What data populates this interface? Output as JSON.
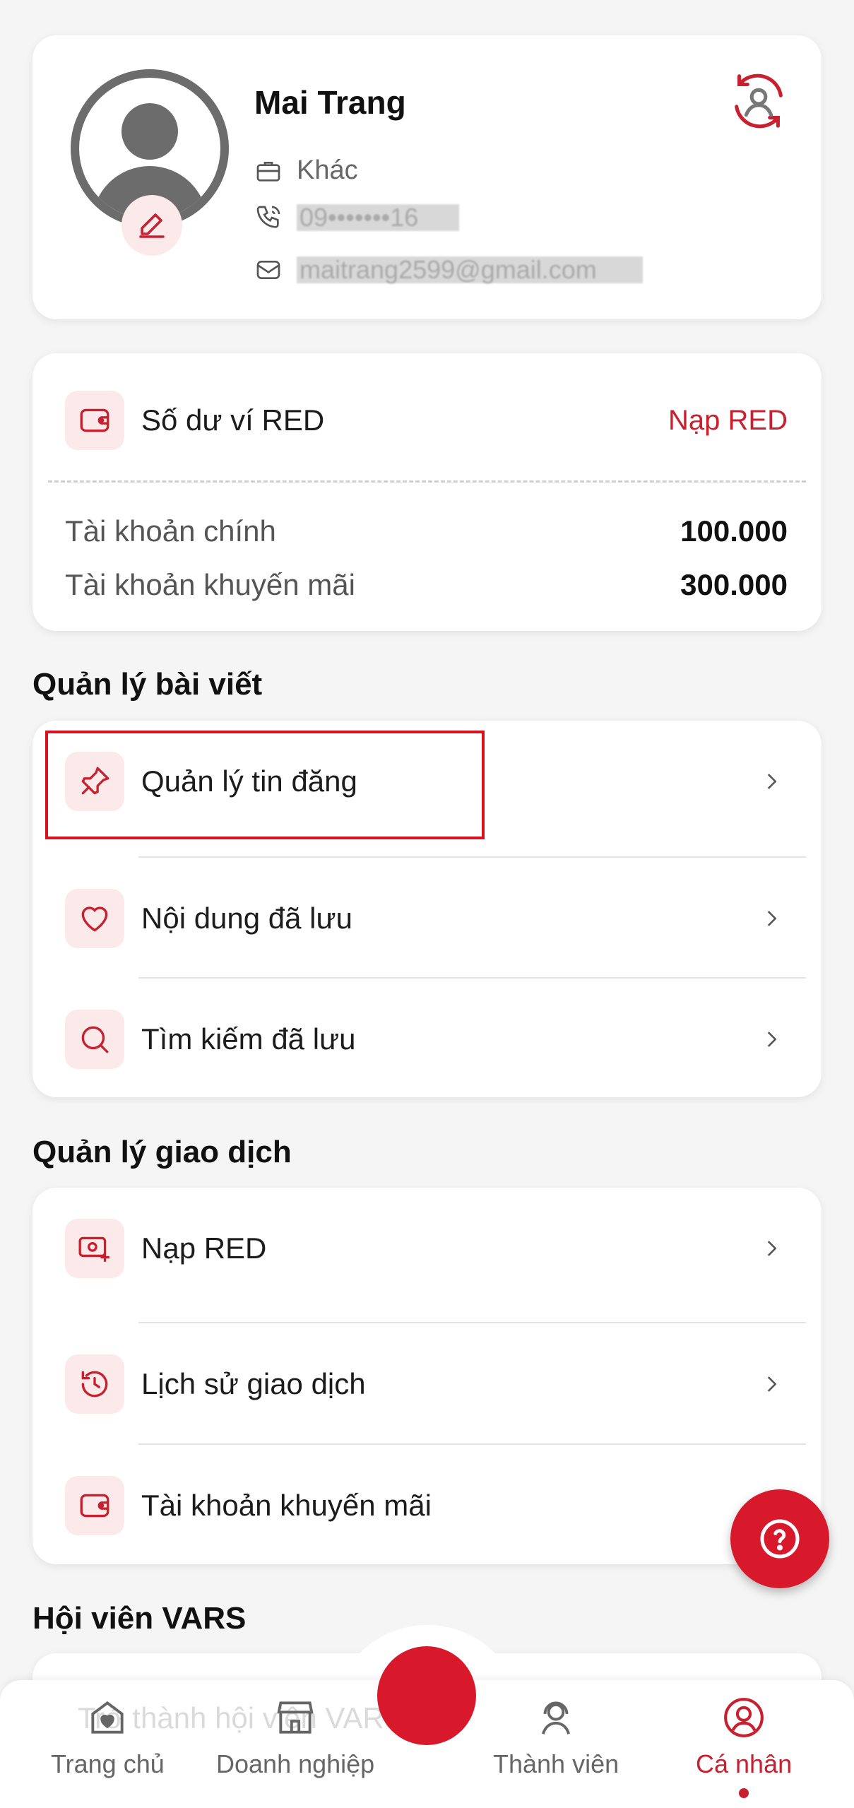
{
  "profile": {
    "name": "Mai Trang",
    "category": "Khác",
    "phone": "09•••••••16",
    "email": "maitrang2599@gmail.com"
  },
  "wallet": {
    "title": "Số dư ví RED",
    "topup_label": "Nạp RED",
    "main_label": "Tài khoản chính",
    "main_value": "100.000",
    "promo_label": "Tài khoản khuyến mãi",
    "promo_value": "300.000"
  },
  "posts_section": {
    "title": "Quản lý bài viết",
    "items": [
      {
        "label": "Quản lý tin đăng",
        "icon": "pin-icon"
      },
      {
        "label": "Nội dung đã lưu",
        "icon": "heart-icon"
      },
      {
        "label": "Tìm kiếm đã lưu",
        "icon": "search-icon"
      }
    ]
  },
  "transactions_section": {
    "title": "Quản lý giao dịch",
    "items": [
      {
        "label": "Nạp RED",
        "icon": "topup-icon"
      },
      {
        "label": "Lịch sử giao dịch",
        "icon": "history-icon"
      },
      {
        "label": "Tài khoản khuyến mãi",
        "icon": "wallet-icon"
      }
    ]
  },
  "vars_section": {
    "title": "Hội viên VARS",
    "peek_text": "Trở thành hội viên VARS"
  },
  "nav": {
    "items": [
      {
        "label": "Trang chủ",
        "icon": "home-icon"
      },
      {
        "label": "Doanh nghiệp",
        "icon": "store-icon"
      },
      {
        "label": "Thành viên",
        "icon": "member-icon"
      },
      {
        "label": "Cá nhân",
        "icon": "user-icon",
        "active": true
      }
    ]
  },
  "colors": {
    "accent": "#c8202f",
    "accent_light": "#fce9ea",
    "background": "#f5f5f5"
  }
}
